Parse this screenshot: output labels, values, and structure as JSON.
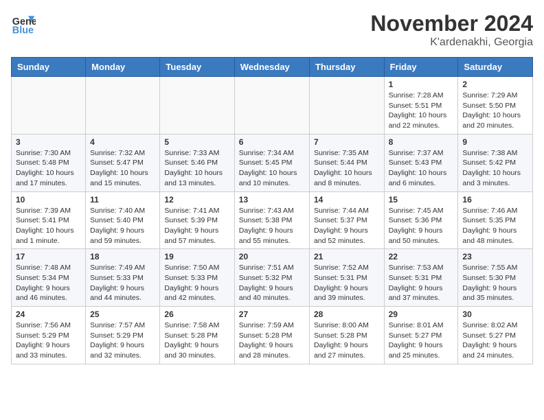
{
  "header": {
    "logo_line1": "General",
    "logo_line2": "Blue",
    "month": "November 2024",
    "location": "K'ardenakhi, Georgia"
  },
  "weekdays": [
    "Sunday",
    "Monday",
    "Tuesday",
    "Wednesday",
    "Thursday",
    "Friday",
    "Saturday"
  ],
  "weeks": [
    [
      {
        "day": "",
        "content": ""
      },
      {
        "day": "",
        "content": ""
      },
      {
        "day": "",
        "content": ""
      },
      {
        "day": "",
        "content": ""
      },
      {
        "day": "",
        "content": ""
      },
      {
        "day": "1",
        "content": "Sunrise: 7:28 AM\nSunset: 5:51 PM\nDaylight: 10 hours\nand 22 minutes."
      },
      {
        "day": "2",
        "content": "Sunrise: 7:29 AM\nSunset: 5:50 PM\nDaylight: 10 hours\nand 20 minutes."
      }
    ],
    [
      {
        "day": "3",
        "content": "Sunrise: 7:30 AM\nSunset: 5:48 PM\nDaylight: 10 hours\nand 17 minutes."
      },
      {
        "day": "4",
        "content": "Sunrise: 7:32 AM\nSunset: 5:47 PM\nDaylight: 10 hours\nand 15 minutes."
      },
      {
        "day": "5",
        "content": "Sunrise: 7:33 AM\nSunset: 5:46 PM\nDaylight: 10 hours\nand 13 minutes."
      },
      {
        "day": "6",
        "content": "Sunrise: 7:34 AM\nSunset: 5:45 PM\nDaylight: 10 hours\nand 10 minutes."
      },
      {
        "day": "7",
        "content": "Sunrise: 7:35 AM\nSunset: 5:44 PM\nDaylight: 10 hours\nand 8 minutes."
      },
      {
        "day": "8",
        "content": "Sunrise: 7:37 AM\nSunset: 5:43 PM\nDaylight: 10 hours\nand 6 minutes."
      },
      {
        "day": "9",
        "content": "Sunrise: 7:38 AM\nSunset: 5:42 PM\nDaylight: 10 hours\nand 3 minutes."
      }
    ],
    [
      {
        "day": "10",
        "content": "Sunrise: 7:39 AM\nSunset: 5:41 PM\nDaylight: 10 hours\nand 1 minute."
      },
      {
        "day": "11",
        "content": "Sunrise: 7:40 AM\nSunset: 5:40 PM\nDaylight: 9 hours\nand 59 minutes."
      },
      {
        "day": "12",
        "content": "Sunrise: 7:41 AM\nSunset: 5:39 PM\nDaylight: 9 hours\nand 57 minutes."
      },
      {
        "day": "13",
        "content": "Sunrise: 7:43 AM\nSunset: 5:38 PM\nDaylight: 9 hours\nand 55 minutes."
      },
      {
        "day": "14",
        "content": "Sunrise: 7:44 AM\nSunset: 5:37 PM\nDaylight: 9 hours\nand 52 minutes."
      },
      {
        "day": "15",
        "content": "Sunrise: 7:45 AM\nSunset: 5:36 PM\nDaylight: 9 hours\nand 50 minutes."
      },
      {
        "day": "16",
        "content": "Sunrise: 7:46 AM\nSunset: 5:35 PM\nDaylight: 9 hours\nand 48 minutes."
      }
    ],
    [
      {
        "day": "17",
        "content": "Sunrise: 7:48 AM\nSunset: 5:34 PM\nDaylight: 9 hours\nand 46 minutes."
      },
      {
        "day": "18",
        "content": "Sunrise: 7:49 AM\nSunset: 5:33 PM\nDaylight: 9 hours\nand 44 minutes."
      },
      {
        "day": "19",
        "content": "Sunrise: 7:50 AM\nSunset: 5:33 PM\nDaylight: 9 hours\nand 42 minutes."
      },
      {
        "day": "20",
        "content": "Sunrise: 7:51 AM\nSunset: 5:32 PM\nDaylight: 9 hours\nand 40 minutes."
      },
      {
        "day": "21",
        "content": "Sunrise: 7:52 AM\nSunset: 5:31 PM\nDaylight: 9 hours\nand 39 minutes."
      },
      {
        "day": "22",
        "content": "Sunrise: 7:53 AM\nSunset: 5:31 PM\nDaylight: 9 hours\nand 37 minutes."
      },
      {
        "day": "23",
        "content": "Sunrise: 7:55 AM\nSunset: 5:30 PM\nDaylight: 9 hours\nand 35 minutes."
      }
    ],
    [
      {
        "day": "24",
        "content": "Sunrise: 7:56 AM\nSunset: 5:29 PM\nDaylight: 9 hours\nand 33 minutes."
      },
      {
        "day": "25",
        "content": "Sunrise: 7:57 AM\nSunset: 5:29 PM\nDaylight: 9 hours\nand 32 minutes."
      },
      {
        "day": "26",
        "content": "Sunrise: 7:58 AM\nSunset: 5:28 PM\nDaylight: 9 hours\nand 30 minutes."
      },
      {
        "day": "27",
        "content": "Sunrise: 7:59 AM\nSunset: 5:28 PM\nDaylight: 9 hours\nand 28 minutes."
      },
      {
        "day": "28",
        "content": "Sunrise: 8:00 AM\nSunset: 5:28 PM\nDaylight: 9 hours\nand 27 minutes."
      },
      {
        "day": "29",
        "content": "Sunrise: 8:01 AM\nSunset: 5:27 PM\nDaylight: 9 hours\nand 25 minutes."
      },
      {
        "day": "30",
        "content": "Sunrise: 8:02 AM\nSunset: 5:27 PM\nDaylight: 9 hours\nand 24 minutes."
      }
    ]
  ]
}
